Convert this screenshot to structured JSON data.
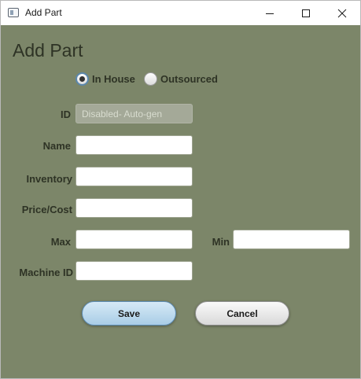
{
  "window": {
    "title": "Add Part",
    "icon": "app-window-icon"
  },
  "form": {
    "heading": "Add Part",
    "source_options": [
      {
        "label": "In House",
        "selected": true
      },
      {
        "label": "Outsourced",
        "selected": false
      }
    ],
    "fields": {
      "id": {
        "label": "ID",
        "value": "",
        "placeholder": "Disabled- Auto-gen",
        "disabled": true
      },
      "name": {
        "label": "Name",
        "value": ""
      },
      "inventory": {
        "label": "Inventory",
        "value": ""
      },
      "price": {
        "label": "Price/Cost",
        "value": ""
      },
      "max": {
        "label": "Max",
        "value": ""
      },
      "min": {
        "label": "Min",
        "value": ""
      },
      "machine_id": {
        "label": "Machine ID",
        "value": ""
      }
    },
    "buttons": {
      "save": "Save",
      "cancel": "Cancel"
    }
  },
  "colors": {
    "background": "#7c8669",
    "text": "#2e3325",
    "save_button": "#a9cde6",
    "cancel_button": "#e6e6e6",
    "disabled_field": "#a4a998"
  }
}
